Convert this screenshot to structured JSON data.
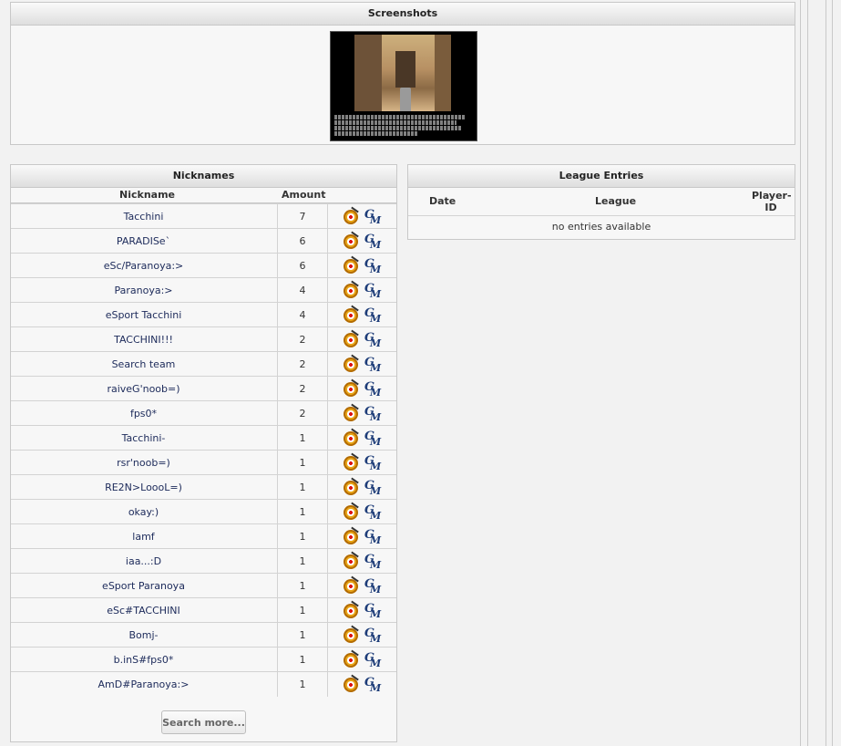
{
  "screenshots": {
    "title": "Screenshots"
  },
  "nicknames": {
    "title": "Nicknames",
    "headers": {
      "nickname": "Nickname",
      "amount": "Amount"
    },
    "rows": [
      {
        "nickname": "Tacchini",
        "amount": "7"
      },
      {
        "nickname": "PARADISe`",
        "amount": "6"
      },
      {
        "nickname": "eSc/Paranoya:>",
        "amount": "6"
      },
      {
        "nickname": "Paranoya:>",
        "amount": "4"
      },
      {
        "nickname": "eSport Tacchini",
        "amount": "4"
      },
      {
        "nickname": "TACCHINI!!!",
        "amount": "2"
      },
      {
        "nickname": "Search team",
        "amount": "2"
      },
      {
        "nickname": "raiveG'noob=)",
        "amount": "2"
      },
      {
        "nickname": "fps0*",
        "amount": "2"
      },
      {
        "nickname": "Tacchini-",
        "amount": "1"
      },
      {
        "nickname": "rsr'noob=)",
        "amount": "1"
      },
      {
        "nickname": "RE2N>LoooL=)",
        "amount": "1"
      },
      {
        "nickname": "okay:)",
        "amount": "1"
      },
      {
        "nickname": "lamf",
        "amount": "1"
      },
      {
        "nickname": "iaa...:D",
        "amount": "1"
      },
      {
        "nickname": "eSport Paranoya",
        "amount": "1"
      },
      {
        "nickname": "eSc#TACCHINI",
        "amount": "1"
      },
      {
        "nickname": "Bomj-",
        "amount": "1"
      },
      {
        "nickname": "b.inS#fps0*",
        "amount": "1"
      },
      {
        "nickname": "AmD#Paranoya:>",
        "amount": "1"
      }
    ],
    "search_more_label": "Search more..."
  },
  "league": {
    "title": "League Entries",
    "headers": {
      "date": "Date",
      "league": "League",
      "player_id": "Player-ID"
    },
    "empty_text": "no entries available"
  },
  "icons": [
    "target-icon",
    "gm-icon"
  ],
  "colors": {
    "link": "#1c2a5a",
    "gm_icon": "#1d3c78",
    "target_icon": "#e8a416"
  }
}
